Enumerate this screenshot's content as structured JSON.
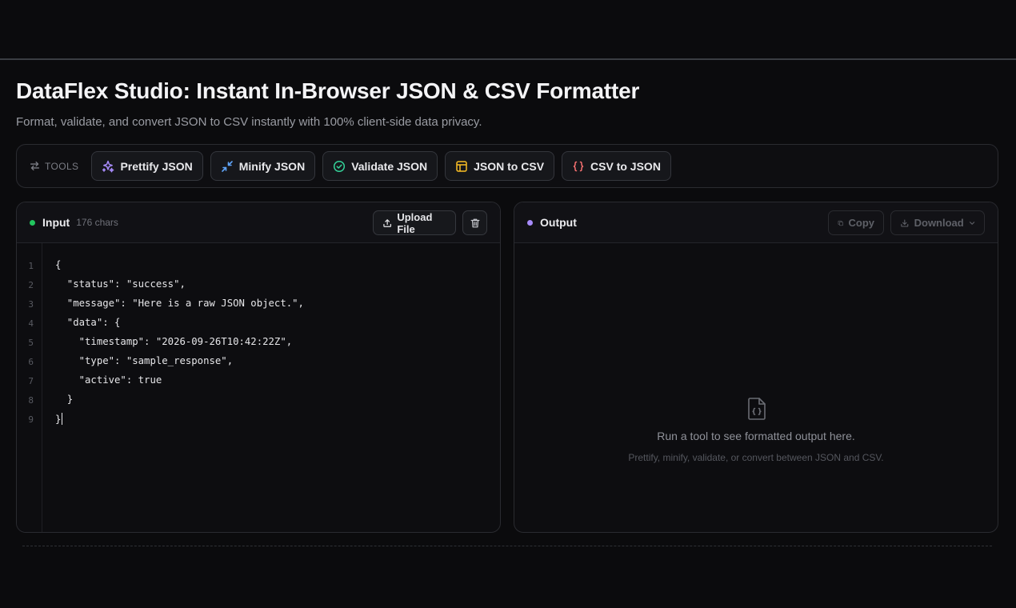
{
  "header": {
    "title": "DataFlex Studio: Instant In-Browser JSON & CSV Formatter",
    "subtitle": "Format, validate, and convert JSON to CSV instantly with 100% client-side data privacy."
  },
  "toolbar": {
    "label": "TOOLS",
    "buttons": [
      {
        "label": "Prettify JSON",
        "icon": "sparkles-icon",
        "color": "#a78bfa"
      },
      {
        "label": "Minify JSON",
        "icon": "minimize-arrows-icon",
        "color": "#60a5fa"
      },
      {
        "label": "Validate JSON",
        "icon": "check-circle-icon",
        "color": "#34d399"
      },
      {
        "label": "JSON to CSV",
        "icon": "table-icon",
        "color": "#fbbf24"
      },
      {
        "label": "CSV to JSON",
        "icon": "braces-icon",
        "color": "#f87171"
      }
    ]
  },
  "input_panel": {
    "title": "Input",
    "char_count": "176 chars",
    "status_color": "#22c55e",
    "upload_label": "Upload File",
    "lines": [
      "{",
      "  \"status\": \"success\",",
      "  \"message\": \"Here is a raw JSON object.\",",
      "  \"data\": {",
      "    \"timestamp\": \"2026-09-26T10:42:22Z\",",
      "    \"type\": \"sample_response\",",
      "    \"active\": true",
      "  }",
      "}"
    ],
    "line_numbers": [
      "1",
      "2",
      "3",
      "4",
      "5",
      "6",
      "7",
      "8",
      "9"
    ]
  },
  "output_panel": {
    "title": "Output",
    "status_color": "#a78bfa",
    "copy_label": "Copy",
    "download_label": "Download",
    "empty_title": "Run a tool to see formatted output here.",
    "empty_subtitle": "Prettify, minify, validate, or convert between JSON and CSV."
  }
}
